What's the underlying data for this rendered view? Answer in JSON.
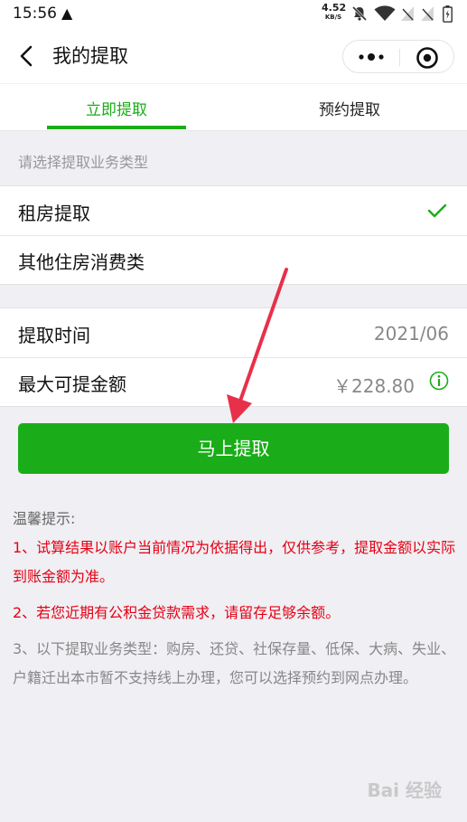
{
  "status_bar": {
    "time": "15:56",
    "network_speed": "4.52",
    "network_speed_unit": "KB/S"
  },
  "navbar": {
    "title": "我的提取"
  },
  "tabs": [
    {
      "label": "立即提取",
      "active": true
    },
    {
      "label": "预约提取",
      "active": false
    }
  ],
  "business_type": {
    "section_label": "请选择提取业务类型",
    "options": [
      {
        "label": "租房提取",
        "selected": true
      },
      {
        "label": "其他住房消费类",
        "selected": false
      }
    ]
  },
  "info": {
    "time_label": "提取时间",
    "time_value": "2021/06",
    "max_amount_label": "最大可提金额",
    "max_amount_value": "￥228.80"
  },
  "primary_button": {
    "label": "马上提取"
  },
  "tips": {
    "title": "温馨提示:",
    "items": [
      {
        "text": "1、试算结果以账户当前情况为依据得出，仅供参考，提取金额以实际到账金额为准。"
      },
      {
        "text": "2、若您近期有公积金贷款需求，请留存足够余额。"
      },
      {
        "text": "3、以下提取业务类型：购房、还贷、社保存量、低保、大病、失业、户籍迁出本市暂不支持线上办理，您可以选择预约到网点办理。"
      }
    ]
  },
  "watermark": "Bai 经验",
  "colors": {
    "accent": "#1aad19",
    "warning_text": "#e60012",
    "annotation_arrow": "#e8304a"
  }
}
